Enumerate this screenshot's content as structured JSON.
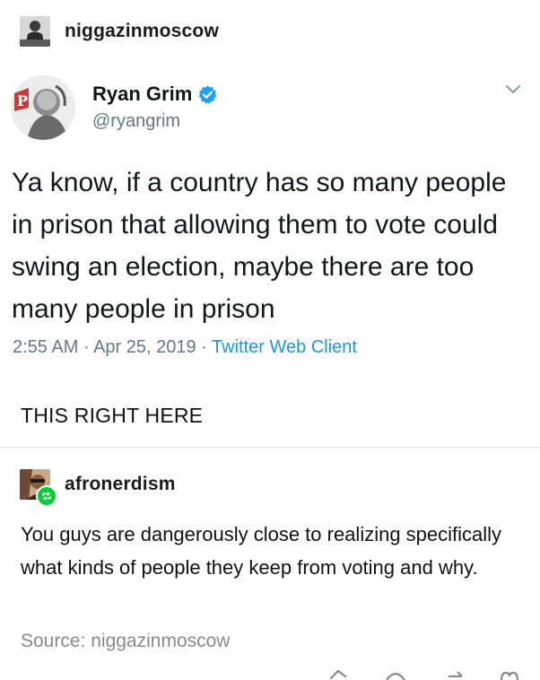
{
  "post": {
    "poster_name": "niggazinmoscow",
    "tweet": {
      "display_name": "Ryan Grim",
      "handle": "@ryangrim",
      "text": "Ya know, if a country has so many people in prison that allowing them to vote could swing an election, maybe there are too many people in prison",
      "time": "2:55 AM",
      "separator": "·",
      "date": "Apr 25, 2019",
      "client": "Twitter Web Client"
    },
    "comment": "THIS RIGHT HERE"
  },
  "reblog": {
    "reblogger_name": "afronerdism",
    "comment": "You guys are dangerously close to realizing specifically what kinds of people they keep from voting and why.",
    "source_label": "Source:",
    "source_name": "niggazinmoscow"
  },
  "icons": {
    "verified": "verified-badge-icon",
    "menu": "chevron-down-icon",
    "reblog": "reblog-icon",
    "actions": [
      "share-icon",
      "comment-icon",
      "reblog-icon",
      "like-icon"
    ]
  },
  "colors": {
    "twitter_blue": "#1b95e0",
    "verified_blue": "#1da1f2",
    "muted_gray": "#657786",
    "reblog_green": "#00cf35"
  }
}
